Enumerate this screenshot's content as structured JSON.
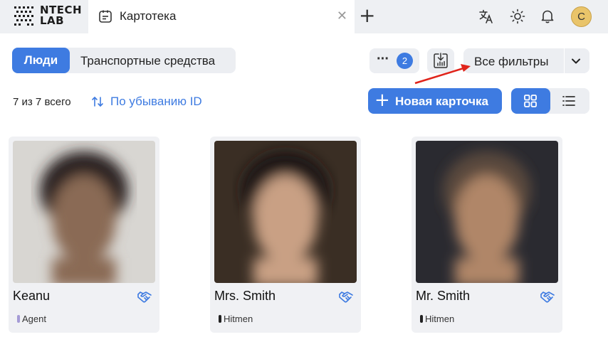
{
  "app": {
    "logo_line1": "NTECH",
    "logo_line2": "LAB",
    "tab_label": "Картотека",
    "avatar_letter": "С"
  },
  "toolbar": {
    "segments": [
      "Люди",
      "Транспортные средства"
    ],
    "active_segment": "Люди",
    "filter_badge": "2",
    "filters_label": "Все фильтры"
  },
  "listing": {
    "count_text": "7 из 7 всего",
    "sort_label": "По убыванию ID",
    "new_card_label": "Новая карточка"
  },
  "cards": [
    {
      "name": "Keanu",
      "role": "Agent",
      "role_color": "#a59bd6",
      "photo_bg": "#d8d6d2",
      "face": "#8a6a55",
      "hair": "#2b2420"
    },
    {
      "name": "Mrs. Smith",
      "role": "Hitmen",
      "role_color": "#222222",
      "photo_bg": "#3a2e24",
      "face": "#c9a084",
      "hair": "#1e1713"
    },
    {
      "name": "Mr. Smith",
      "role": "Hitmen",
      "role_color": "#222222",
      "photo_bg": "#2a2a30",
      "face": "#b08668",
      "hair": "#5a4a3e"
    }
  ],
  "colors": {
    "accent": "#3e7be1",
    "annotation_arrow": "#e0241b"
  }
}
